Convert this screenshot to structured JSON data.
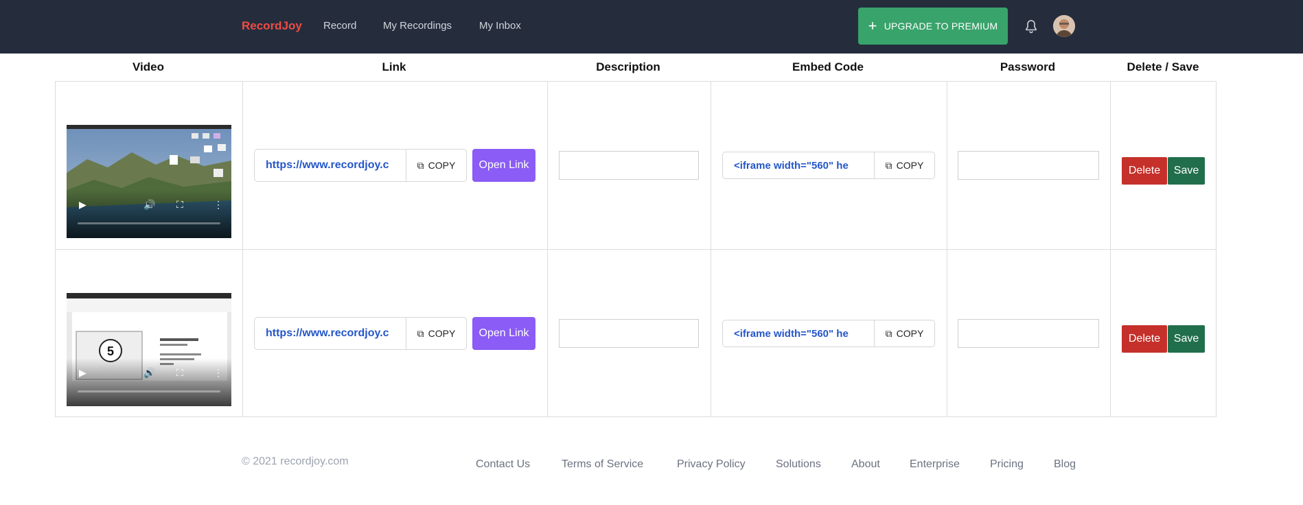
{
  "nav": {
    "brand": "RecordJoy",
    "items": [
      "Record",
      "My Recordings",
      "My Inbox"
    ],
    "upgrade_label": "UPGRADE TO PREMIUM"
  },
  "table": {
    "headers": [
      "Video",
      "Link",
      "Description",
      "Embed Code",
      "Password",
      "Delete / Save"
    ],
    "rows": [
      {
        "link": "https://www.recordjoy.c",
        "copy_label": "COPY",
        "open_label": "Open Link",
        "description": "",
        "embed": "<iframe width=\"560\" he",
        "embed_copy_label": "COPY",
        "password": "",
        "delete_label": "Delete",
        "save_label": "Save"
      },
      {
        "link": "https://www.recordjoy.c",
        "copy_label": "COPY",
        "open_label": "Open Link",
        "description": "",
        "embed": "<iframe width=\"560\" he",
        "embed_copy_label": "COPY",
        "password": "",
        "delete_label": "Delete",
        "save_label": "Save"
      }
    ],
    "video2_countdown": "5"
  },
  "footer": {
    "copyright": "© 2021 recordjoy.com",
    "links": [
      "Contact Us",
      "Terms of Service",
      "Privacy Policy",
      "Solutions",
      "About",
      "Enterprise",
      "Pricing",
      "Blog"
    ]
  },
  "colors": {
    "header_bg": "#252d3d",
    "brand": "#ef4c45",
    "upgrade": "#38a36b",
    "open_link": "#8b5cf6",
    "delete": "#c5302a",
    "save": "#216e4c",
    "link_text": "#2456c8"
  }
}
